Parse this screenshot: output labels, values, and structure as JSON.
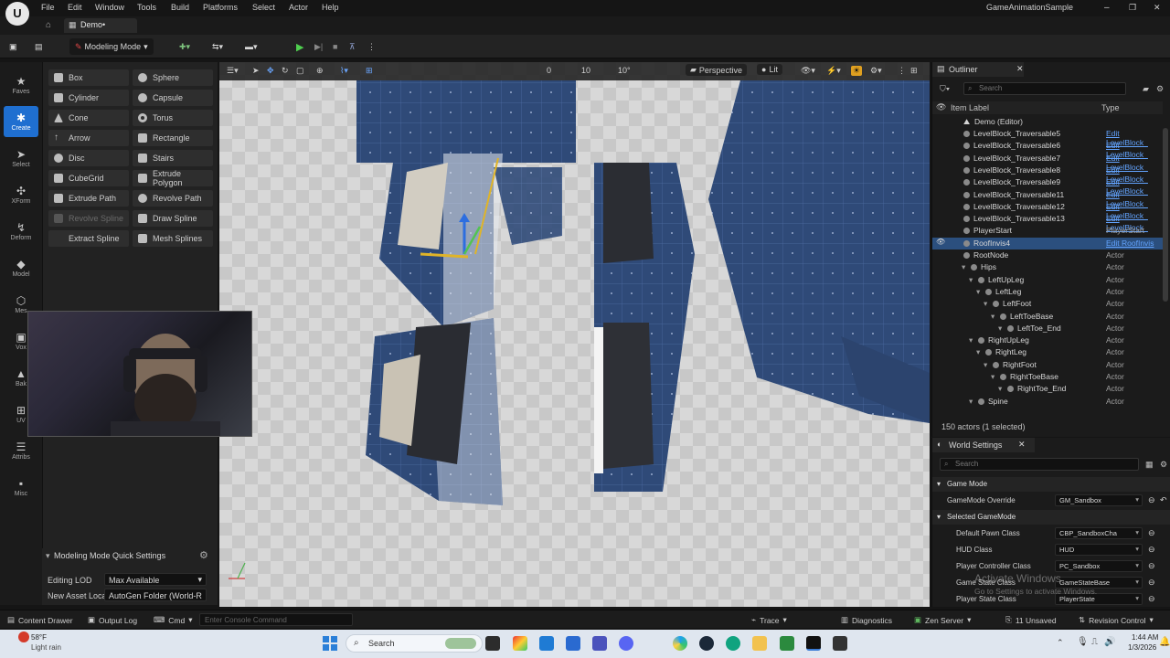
{
  "app": {
    "project_name": "GameAnimationSample",
    "menus": [
      "File",
      "Edit",
      "Window",
      "Tools",
      "Build",
      "Platforms",
      "Select",
      "Actor",
      "Help"
    ],
    "level_tab": "Demo•"
  },
  "toolbar": {
    "mode_label": "Modeling Mode"
  },
  "left_palettes": [
    {
      "label": "Faves",
      "icon": "star-icon"
    },
    {
      "label": "Create",
      "icon": "create-icon",
      "active": true
    },
    {
      "label": "Select",
      "icon": "cursor-icon"
    },
    {
      "label": "XForm",
      "icon": "transform-icon"
    },
    {
      "label": "Deform",
      "icon": "deform-icon"
    },
    {
      "label": "Model",
      "icon": "model-icon"
    },
    {
      "label": "Mes",
      "icon": "mesh-icon"
    },
    {
      "label": "Vox",
      "icon": "voxel-icon"
    },
    {
      "label": "Bak",
      "icon": "bake-icon"
    },
    {
      "label": "UV",
      "icon": "uv-icon"
    },
    {
      "label": "Attribs",
      "icon": "attribs-icon"
    },
    {
      "label": "Misc",
      "icon": "misc-icon"
    }
  ],
  "tools": [
    {
      "label": "Box"
    },
    {
      "label": "Sphere"
    },
    {
      "label": "Cylinder"
    },
    {
      "label": "Capsule"
    },
    {
      "label": "Cone"
    },
    {
      "label": "Torus"
    },
    {
      "label": "Arrow"
    },
    {
      "label": "Rectangle"
    },
    {
      "label": "Disc"
    },
    {
      "label": "Stairs"
    },
    {
      "label": "CubeGrid"
    },
    {
      "label": "Extrude Polygon"
    },
    {
      "label": "Extrude Path"
    },
    {
      "label": "Revolve Path"
    },
    {
      "label": "Revolve Spline",
      "disabled": true
    },
    {
      "label": "Draw Spline"
    },
    {
      "label": "Extract Spline"
    },
    {
      "label": "Mesh Splines"
    }
  ],
  "quick_settings": {
    "title": "Modeling Mode Quick Settings",
    "editing_lod_label": "Editing LOD",
    "editing_lod_value": "Max Available",
    "new_asset_label": "New Asset Loca",
    "new_asset_value": "AutoGen Folder (World-R"
  },
  "viewport": {
    "perspective_label": "Perspective",
    "lit_label": "Lit",
    "snap_values": [
      "0",
      "10",
      "10°"
    ]
  },
  "outliner": {
    "title": "Outliner",
    "search_placeholder": "Search",
    "col_label": "Item Label",
    "col_type": "Type",
    "root": "Demo (Editor)",
    "rows": [
      {
        "label": "LevelBlock_Traversable5",
        "type": "Edit LevelBlock_",
        "indent": 1,
        "link": true
      },
      {
        "label": "LevelBlock_Traversable6",
        "type": "Edit LevelBlock_",
        "indent": 1,
        "link": true
      },
      {
        "label": "LevelBlock_Traversable7",
        "type": "Edit LevelBlock_",
        "indent": 1,
        "link": true
      },
      {
        "label": "LevelBlock_Traversable8",
        "type": "Edit LevelBlock_",
        "indent": 1,
        "link": true
      },
      {
        "label": "LevelBlock_Traversable9",
        "type": "Edit LevelBlock_",
        "indent": 1,
        "link": true
      },
      {
        "label": "LevelBlock_Traversable11",
        "type": "Edit LevelBlock_",
        "indent": 1,
        "link": true
      },
      {
        "label": "LevelBlock_Traversable12",
        "type": "Edit LevelBlock_",
        "indent": 1,
        "link": true
      },
      {
        "label": "LevelBlock_Traversable13",
        "type": "Edit LevelBlock_",
        "indent": 1,
        "link": true
      },
      {
        "label": "PlayerStart",
        "type": "PlayerStart",
        "indent": 1
      },
      {
        "label": "RoofInvis4",
        "type": "Edit RoofInvis",
        "indent": 1,
        "link": true,
        "selected": true
      },
      {
        "label": "RootNode",
        "type": "Actor",
        "indent": 1
      },
      {
        "label": "Hips",
        "type": "Actor",
        "indent": 2
      },
      {
        "label": "LeftUpLeg",
        "type": "Actor",
        "indent": 3
      },
      {
        "label": "LeftLeg",
        "type": "Actor",
        "indent": 4
      },
      {
        "label": "LeftFoot",
        "type": "Actor",
        "indent": 5
      },
      {
        "label": "LeftToeBase",
        "type": "Actor",
        "indent": 6
      },
      {
        "label": "LeftToe_End",
        "type": "Actor",
        "indent": 7
      },
      {
        "label": "RightUpLeg",
        "type": "Actor",
        "indent": 3
      },
      {
        "label": "RightLeg",
        "type": "Actor",
        "indent": 4
      },
      {
        "label": "RightFoot",
        "type": "Actor",
        "indent": 5
      },
      {
        "label": "RightToeBase",
        "type": "Actor",
        "indent": 6
      },
      {
        "label": "RightToe_End",
        "type": "Actor",
        "indent": 7
      },
      {
        "label": "Spine",
        "type": "Actor",
        "indent": 3
      }
    ],
    "footer": "150 actors (1 selected)"
  },
  "world_settings": {
    "title": "World Settings",
    "search_placeholder": "Search",
    "cat_game_mode": "Game Mode",
    "gamemode_override_label": "GameMode Override",
    "gamemode_override_value": "GM_Sandbox",
    "cat_selected": "Selected GameMode",
    "props": [
      {
        "k": "Default Pawn Class",
        "v": "CBP_SandboxCha"
      },
      {
        "k": "HUD Class",
        "v": "HUD"
      },
      {
        "k": "Player Controller Class",
        "v": "PC_Sandbox"
      },
      {
        "k": "Game State Class",
        "v": "GameStateBase"
      },
      {
        "k": "Player State Class",
        "v": "PlayerState"
      }
    ],
    "activate_title": "Activate Windows",
    "activate_sub": "Go to Settings to activate Windows."
  },
  "statusbar": {
    "content_drawer": "Content Drawer",
    "output_log": "Output Log",
    "cmd": "Cmd",
    "console_placeholder": "Enter Console Command",
    "trace": "Trace",
    "diagnostics": "Diagnostics",
    "zen": "Zen Server",
    "unsaved": "11 Unsaved",
    "revision": "Revision Control"
  },
  "taskbar": {
    "weather_temp": "58°F",
    "weather_desc": "Light rain",
    "search": "Search",
    "time": "1:44 AM",
    "date": "1/3/2026"
  }
}
